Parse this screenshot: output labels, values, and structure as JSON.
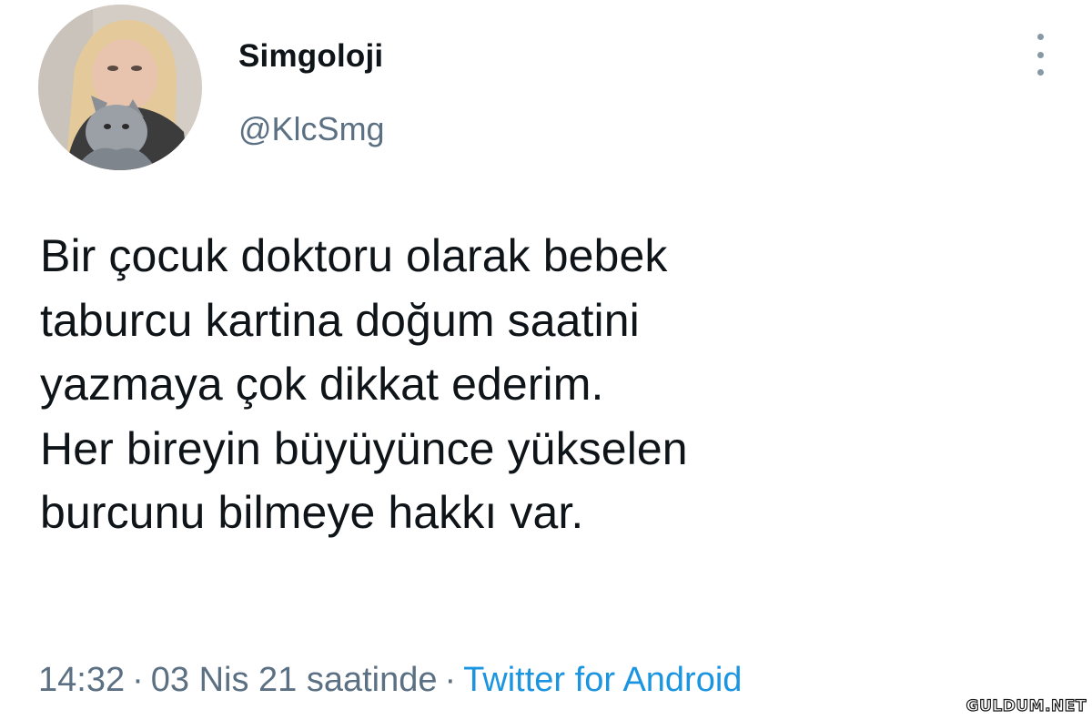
{
  "author": {
    "display_name": "Simgoloji",
    "handle": "@KlcSmg",
    "avatar_icon": "profile-photo"
  },
  "menu": {
    "more_icon": "more-vertical-icon"
  },
  "tweet": {
    "lines": [
      "Bir çocuk doktoru olarak bebek",
      "taburcu kartina doğum saatini",
      "yazmaya çok dikkat ederim.",
      "Her bireyin büyüyünce yükselen",
      "burcunu bilmeye hakkı var."
    ]
  },
  "meta": {
    "time": "14:32",
    "date": "03 Nis 21 saatinde",
    "separator": "·",
    "source": "Twitter for Android"
  },
  "watermark": {
    "text": "GULDUM.NET"
  },
  "colors": {
    "text": "#0f1419",
    "secondary": "#5b7083",
    "link": "#1b95e0"
  }
}
